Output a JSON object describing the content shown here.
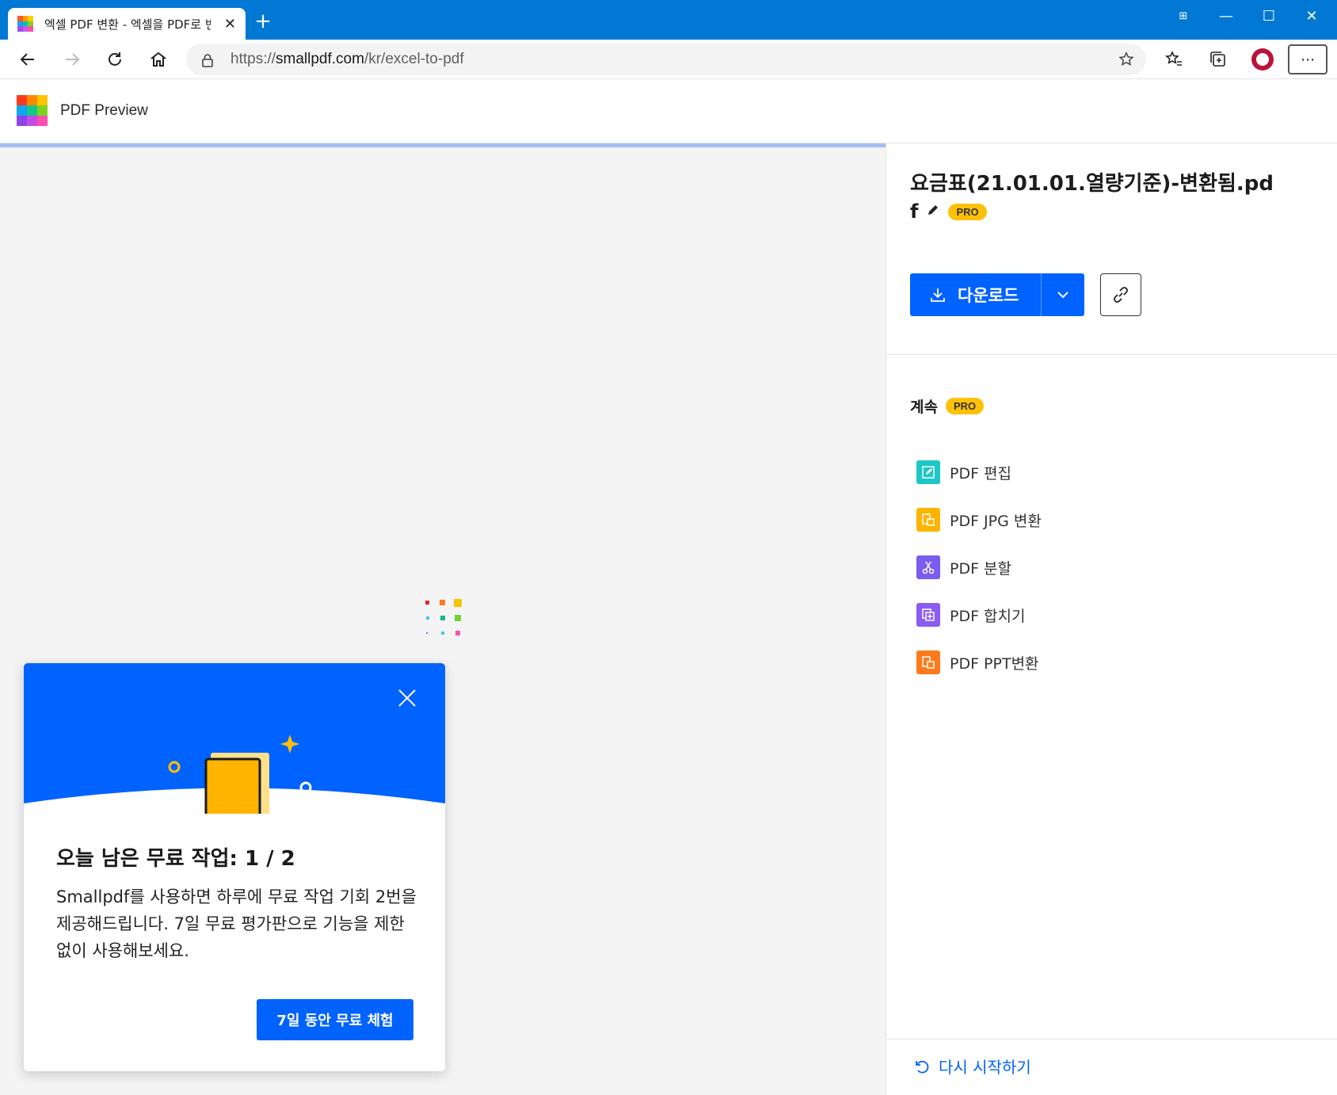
{
  "browser": {
    "tab_title": "엑셀 PDF 변환 - 엑셀을 PDF로 변환",
    "url_scheme": "https://",
    "url_host": "smallpdf.com",
    "url_path": "/kr/excel-to-pdf"
  },
  "app": {
    "name": "PDF Preview"
  },
  "file": {
    "name": "요금표(21.01.01.열량기준)-변환됨.pd",
    "ext_letter": "f",
    "pro_badge": "PRO"
  },
  "actions": {
    "download_label": "다운로드"
  },
  "continue": {
    "label": "계속",
    "pro_badge": "PRO",
    "tools": [
      {
        "label": "PDF 편집",
        "color": "#1ec7c7"
      },
      {
        "label": "PDF JPG 변환",
        "color": "#ffb400"
      },
      {
        "label": "PDF 분할",
        "color": "#7b5cf0"
      },
      {
        "label": "PDF 합치기",
        "color": "#8c5cf2"
      },
      {
        "label": "PDF PPT변환",
        "color": "#ff7a1a"
      }
    ]
  },
  "restart": {
    "label": "다시 시작하기"
  },
  "popup": {
    "title": "오늘 남은 무료 작업: 1 / 2",
    "body": "Smallpdf를 사용하면 하루에 무료 작업 기회 2번을 제공해드립니다. 7일 무료 평가판으로 기능을 제한 없이 사용해보세요.",
    "cta": "7일 동안 무료 체험"
  },
  "colors": {
    "titlebar": "#0078d4",
    "primary": "#0062ff",
    "pro": "#ffc107"
  }
}
